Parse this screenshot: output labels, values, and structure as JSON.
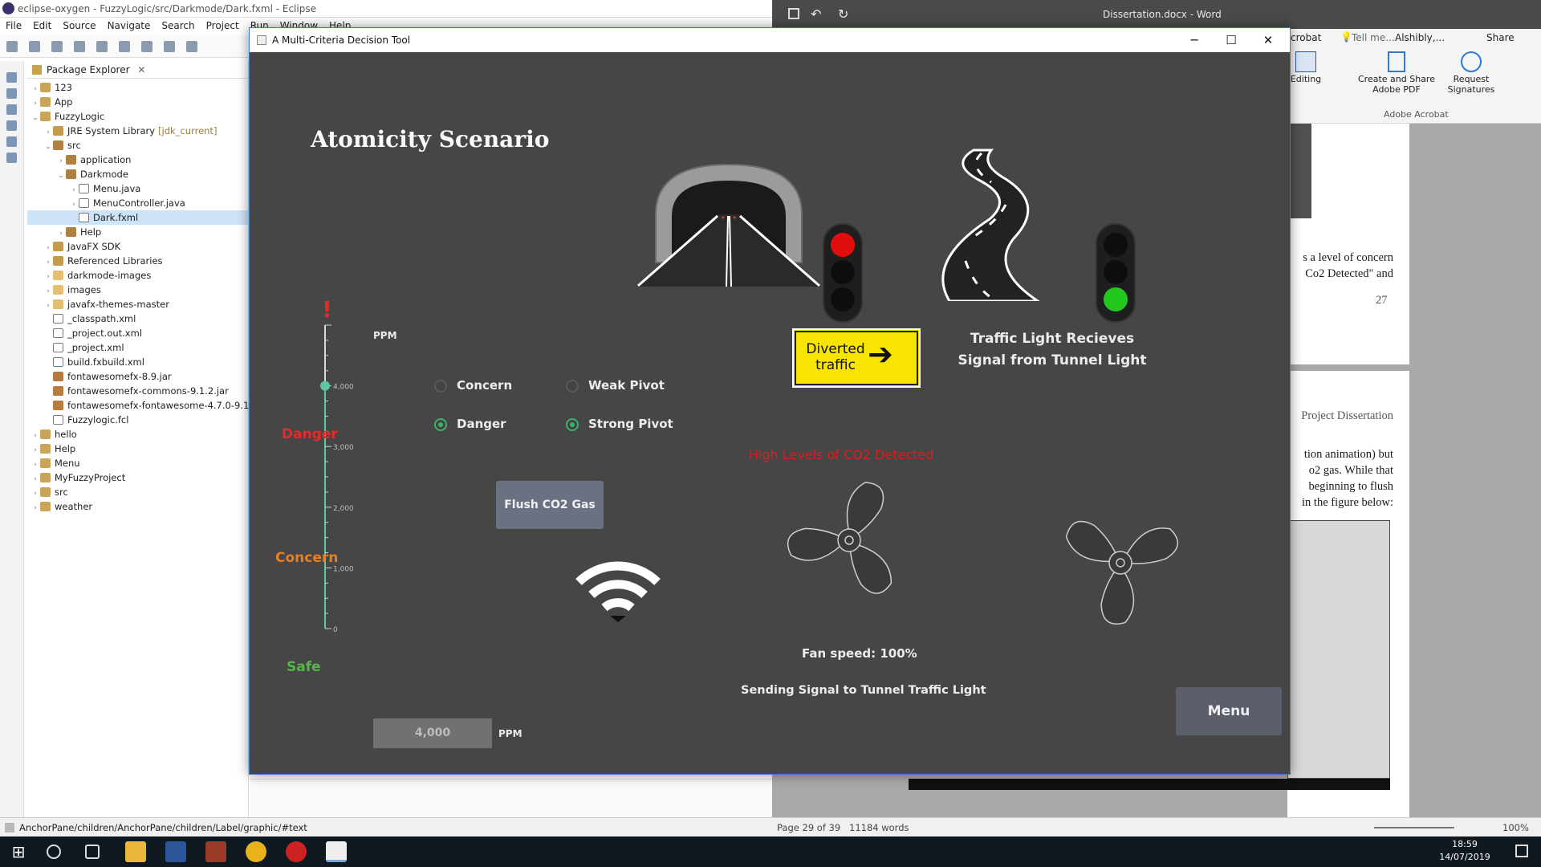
{
  "eclipse": {
    "title": "eclipse-oxygen - FuzzyLogic/src/Darkmode/Dark.fxml - Eclipse",
    "menu": [
      "File",
      "Edit",
      "Source",
      "Navigate",
      "Search",
      "Project",
      "Run",
      "Window",
      "Help"
    ],
    "package_explorer_label": "Package Explorer",
    "tree": [
      {
        "label": "123",
        "level": 0,
        "arrow": "›",
        "icon": "proj"
      },
      {
        "label": "App",
        "level": 0,
        "arrow": "›",
        "icon": "proj"
      },
      {
        "label": "FuzzyLogic",
        "level": 0,
        "arrow": "⌄",
        "icon": "proj"
      },
      {
        "label": "JRE System Library",
        "extra": "[jdk_current]",
        "level": 1,
        "arrow": "›",
        "icon": "lib"
      },
      {
        "label": "src",
        "level": 1,
        "arrow": "⌄",
        "icon": "pkg"
      },
      {
        "label": "application",
        "level": 2,
        "arrow": "›",
        "icon": "pkg"
      },
      {
        "label": "Darkmode",
        "level": 2,
        "arrow": "⌄",
        "icon": "pkg"
      },
      {
        "label": "Menu.java",
        "level": 3,
        "arrow": "›",
        "icon": "file"
      },
      {
        "label": "MenuController.java",
        "level": 3,
        "arrow": "›",
        "icon": "file"
      },
      {
        "label": "Dark.fxml",
        "level": 3,
        "arrow": "",
        "icon": "file",
        "selected": true
      },
      {
        "label": "Help",
        "level": 2,
        "arrow": "›",
        "icon": "pkg"
      },
      {
        "label": "JavaFX SDK",
        "level": 1,
        "arrow": "›",
        "icon": "lib"
      },
      {
        "label": "Referenced Libraries",
        "level": 1,
        "arrow": "›",
        "icon": "lib"
      },
      {
        "label": "darkmode-images",
        "level": 1,
        "arrow": "›",
        "icon": "fold"
      },
      {
        "label": "images",
        "level": 1,
        "arrow": "›",
        "icon": "fold"
      },
      {
        "label": "javafx-themes-master",
        "level": 1,
        "arrow": "›",
        "icon": "fold"
      },
      {
        "label": "_classpath.xml",
        "level": 1,
        "arrow": "",
        "icon": "file"
      },
      {
        "label": "_project.out.xml",
        "level": 1,
        "arrow": "",
        "icon": "file"
      },
      {
        "label": "_project.xml",
        "level": 1,
        "arrow": "",
        "icon": "file"
      },
      {
        "label": "build.fxbuild.xml",
        "level": 1,
        "arrow": "",
        "icon": "file"
      },
      {
        "label": "fontawesomefx-8.9.jar",
        "level": 1,
        "arrow": "",
        "icon": "jar"
      },
      {
        "label": "fontawesomefx-commons-9.1.2.jar",
        "level": 1,
        "arrow": "",
        "icon": "jar"
      },
      {
        "label": "fontawesomefx-fontawesome-4.7.0-9.1.",
        "level": 1,
        "arrow": "",
        "icon": "jar"
      },
      {
        "label": "Fuzzylogic.fcl",
        "level": 1,
        "arrow": "",
        "icon": "file"
      },
      {
        "label": "hello",
        "level": 0,
        "arrow": "›",
        "icon": "proj"
      },
      {
        "label": "Help",
        "level": 0,
        "arrow": "›",
        "icon": "proj"
      },
      {
        "label": "Menu",
        "level": 0,
        "arrow": "›",
        "icon": "proj"
      },
      {
        "label": "MyFuzzyProject",
        "level": 0,
        "arrow": "›",
        "icon": "proj"
      },
      {
        "label": "src",
        "level": 0,
        "arrow": "›",
        "icon": "proj"
      },
      {
        "label": "weather",
        "level": 0,
        "arrow": "›",
        "icon": "proj"
      }
    ],
    "status": "AnchorPane/children/AnchorPane/children/Label/graphic/#text"
  },
  "word": {
    "title": "Dissertation.docx - Word",
    "ribbon_tabs": {
      "acrobat": "Acrobat",
      "tell_me": "Tell me...",
      "user": "Alshibly,...",
      "share": "Share"
    },
    "editing": "Editing",
    "create_share": "Create and Share Adobe PDF",
    "request_sig": "Request Signatures",
    "group": "Adobe Acrobat",
    "page1_lines": [
      "s a level of concern",
      "Co2 Detected\" and"
    ],
    "page_num": "27",
    "page2_lines": [
      "Project Dissertation",
      "tion animation) but",
      "o2 gas. While that",
      "beginning to flush",
      "in the figure below:"
    ],
    "status_page": "Page 29 of 39",
    "status_words": "11184 words",
    "zoom": "100%"
  },
  "taskbar": {
    "time": "18:59",
    "date": "14/07/2019"
  },
  "app": {
    "window_title": "A Multi-Criteria Decision Tool",
    "scenario_title": "Atomicity Scenario",
    "gauge": {
      "unit": "PPM",
      "value": 4000,
      "max": 5000,
      "ticks": [
        "4,000",
        "3,000",
        "2,000",
        "1,000",
        "0"
      ],
      "zones": {
        "danger": "Danger",
        "concern": "Concern",
        "safe": "Safe"
      },
      "colors": {
        "danger": "#e52a2a",
        "concern": "#e67e22",
        "safe": "#54b848",
        "track": "#5ec7a0"
      }
    },
    "radios": [
      {
        "label": "Concern",
        "selected": false
      },
      {
        "label": "Weak Pivot",
        "selected": false
      },
      {
        "label": "Danger",
        "selected": true
      },
      {
        "label": "Strong Pivot",
        "selected": true
      }
    ],
    "flush_button": "Flush CO2 Gas",
    "sign_text": "Diverted traffic",
    "traffic_signal_text": "Traffic Light Recieves Signal from Tunnel Light",
    "alert_text": "High Levels of CO2 Detected",
    "fan_speed": "Fan speed: 100%",
    "sending_signal": "Sending Signal to Tunnel Traffic Light",
    "menu_button": "Menu",
    "ppm_field_value": "4,000",
    "ppm_field_unit": "PPM",
    "lights": {
      "tunnel_light": "red",
      "road_light": "green"
    }
  }
}
